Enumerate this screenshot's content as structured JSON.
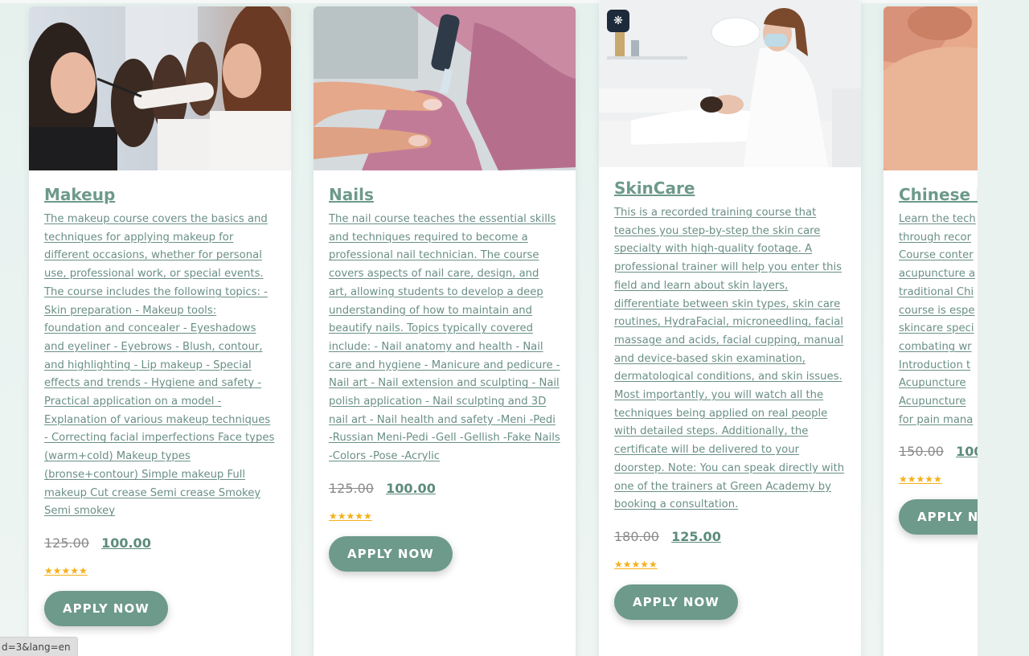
{
  "courses": [
    {
      "title": "Makeup",
      "description": "The makeup course covers the basics and techniques for applying makeup for different occasions, whether for personal use, professional work, or special events. The course includes the following topics: - Skin preparation - Makeup tools: foundation and concealer - Eyeshadows and eyeliner - Eyebrows - Blush, contour, and highlighting - Lip makeup - Special effects and trends - Hygiene and safety - Practical application on a model - Explanation of various makeup techniques - Correcting facial imperfections Face types (warm+cold) Makeup types (bronse+contour) Simple makeup Full makeup Cut crease Semi crease Smokey Semi smokey",
      "old_price": "125.00",
      "new_price": "100.00",
      "stars": "★★★★★",
      "button": "APPLY NOW",
      "image_icon": "makeup-photo"
    },
    {
      "title": "Nails",
      "description": "The nail course teaches the essential skills and techniques required to become a professional nail technician. The course covers aspects of nail care, design, and art, allowing students to develop a deep understanding of how to maintain and beautify nails. Topics typically covered include: - Nail anatomy and health - Nail care and hygiene - Manicure and pedicure - Nail art - Nail extension and sculpting - Nail polish application - Nail sculpting and 3D nail art - Nail health and safety -Meni -Pedi -Russian Meni-Pedi -Gell -Gellish -Fake Nails -Colors -Pose -Acrylic",
      "old_price": "125.00",
      "new_price": "100.00",
      "stars": "★★★★★",
      "button": "APPLY NOW",
      "image_icon": "nails-photo"
    },
    {
      "title": "SkinCare",
      "description": "This is a recorded training course that teaches you step-by-step the skin care specialty with high-quality footage. A professional trainer will help you enter this field and learn about skin layers, differentiate between skin types, skin care routines, HydraFacial, microneedling, facial massage and acids, facial cupping, manual and device-based skin examination, dermatological conditions, and skin issues. Most importantly, you will watch all the techniques being applied on real people with detailed steps. Additionally, the certificate will be delivered to your doorstep. Note: You can speak directly with one of the trainers at Green Academy by booking a consultation.",
      "old_price": "180.00",
      "new_price": "125.00",
      "stars": "★★★★★",
      "button": "APPLY NOW",
      "image_icon": "skincare-photo"
    },
    {
      "title": "Chinese I",
      "description_lines": [
        "Learn the tech",
        "through recor",
        "Course conter",
        "acupuncture a",
        "traditional Chi",
        "course is espe",
        "skincare speci",
        "combating wr",
        "Introduction t",
        "Acupuncture",
        "Acupuncture",
        "for pain mana"
      ],
      "old_price": "150.00",
      "new_price": "100",
      "stars": "★★★★★",
      "button": "APPLY N",
      "image_icon": "acupuncture-photo"
    }
  ],
  "status_bar": "d=3&lang=en",
  "colors": {
    "accent": "#6d9a8a",
    "star": "#f4b01b",
    "description": "#6a8f86"
  }
}
